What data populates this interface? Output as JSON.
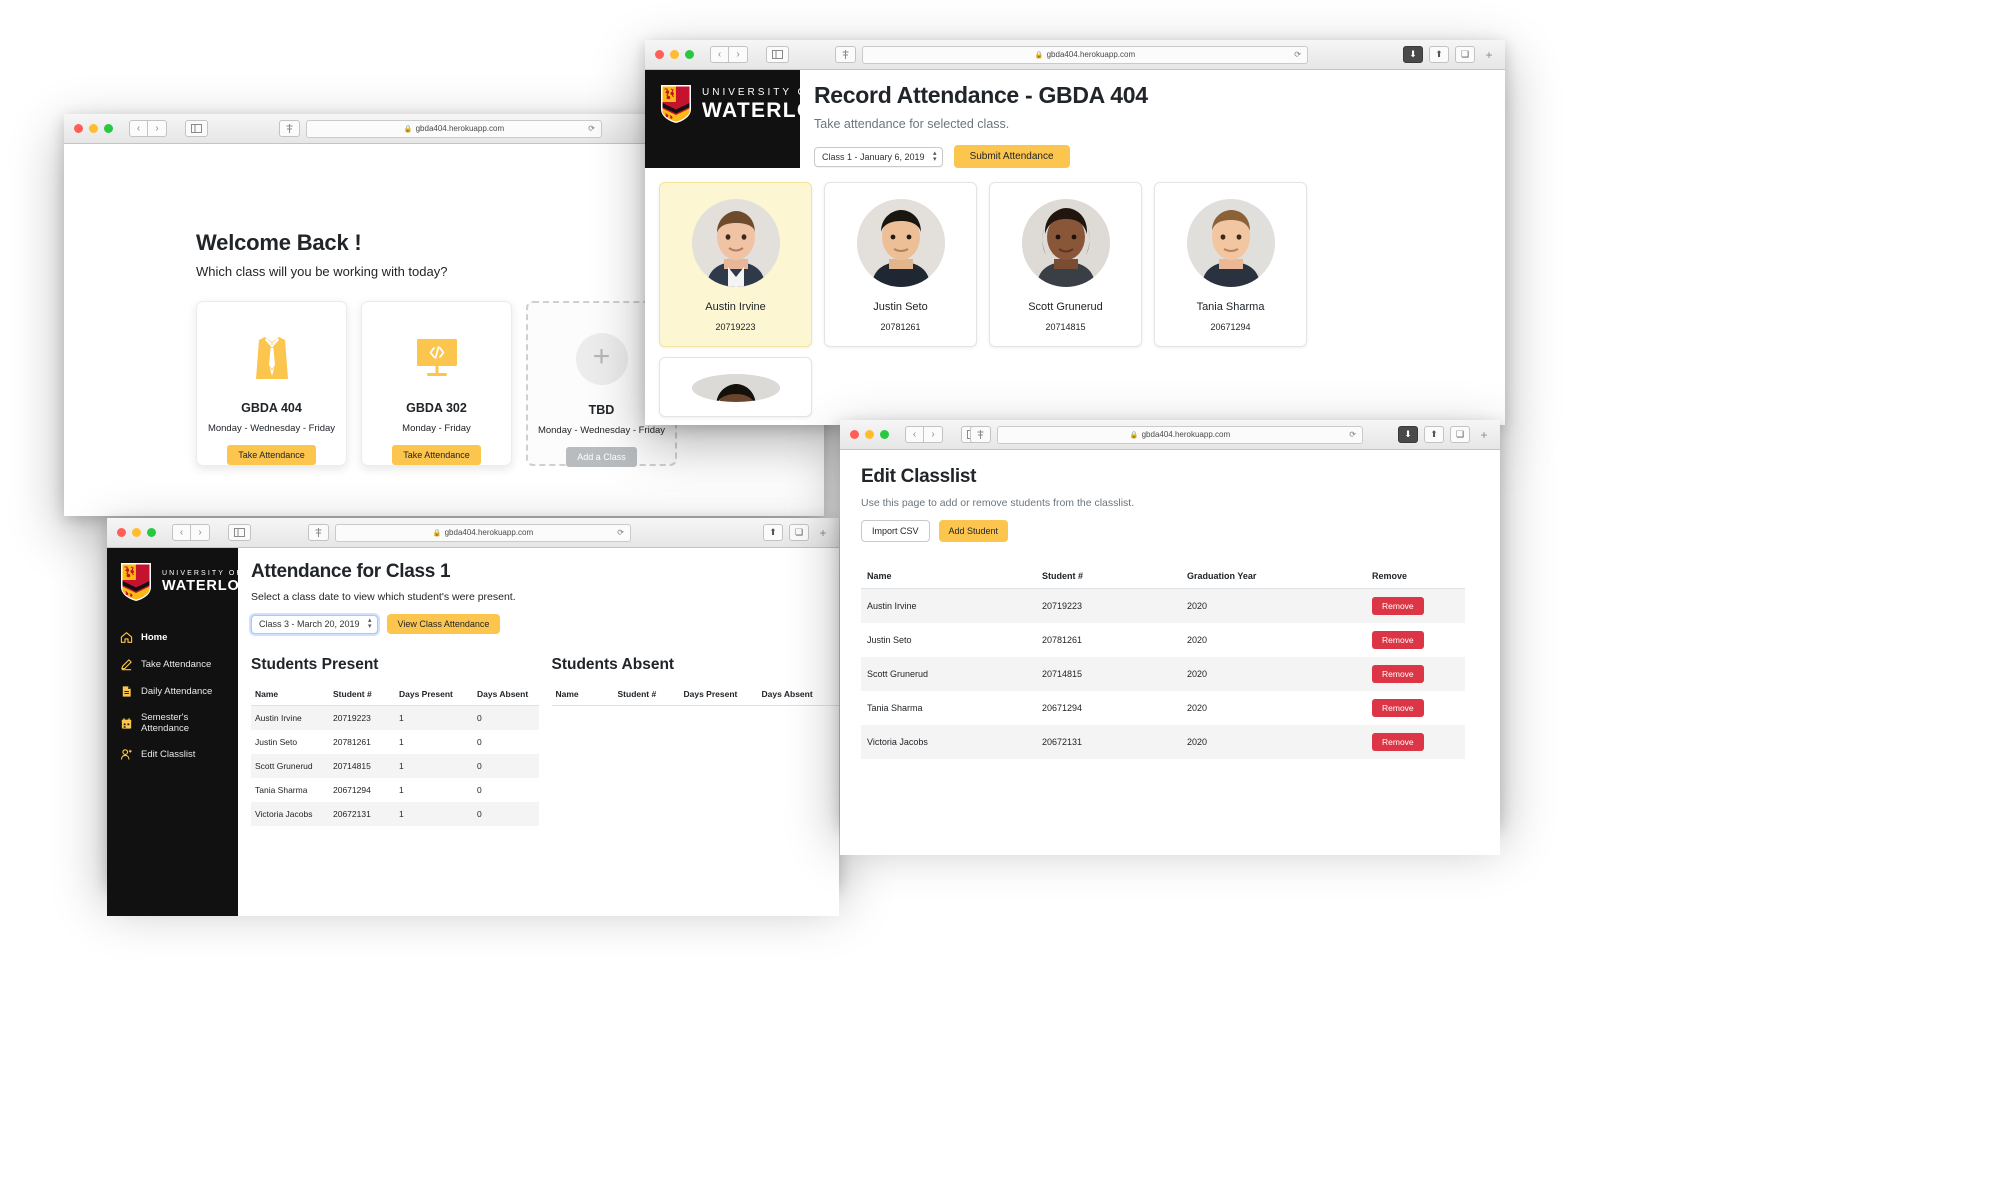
{
  "browser": {
    "url": "gbda404.herokuapp.com",
    "lock_icon": "lock-icon",
    "reload_icon": "reload-icon",
    "back_icon": "chevron-left-icon",
    "forward_icon": "chevron-right-icon",
    "sidebar_icon": "sidebar-toggle-icon",
    "share_icon": "share-icon",
    "download_icon": "download-icon",
    "tabs_icon": "show-tabs-icon",
    "newtab_icon": "plus-icon"
  },
  "brand": {
    "line1": "UNIVERSITY OF",
    "line2": "WATERLOO",
    "accent": "#fcc54d",
    "dark": "#111111",
    "danger": "#dc3545",
    "present": "#1f9d4e",
    "absent": "#e0334a",
    "selected_bg": "#fcf6d2"
  },
  "welcome": {
    "title": "Welcome Back !",
    "subtitle": "Which class will you be working with today?",
    "cards": [
      {
        "icon": "necktie-icon",
        "title": "GBDA 404",
        "days": "Monday - Wednesday - Friday",
        "button": "Take Attendance",
        "state": "normal"
      },
      {
        "icon": "code-monitor-icon",
        "title": "GBDA 302",
        "days": "Monday - Friday",
        "button": "Take Attendance",
        "state": "normal"
      },
      {
        "icon": "plus-icon",
        "title": "TBD",
        "days": "Monday - Wednesday - Friday",
        "button": "Add a Class",
        "state": "placeholder"
      }
    ]
  },
  "record": {
    "title": "Record Attendance - GBDA 404",
    "subtitle": "Take attendance for selected class.",
    "class_select_value": "Class 1 - January 6, 2019",
    "submit_label": "Submit Attendance",
    "students": [
      {
        "name": "Austin Irvine",
        "number": "20719223",
        "selected": true
      },
      {
        "name": "Justin Seto",
        "number": "20781261",
        "selected": false
      },
      {
        "name": "Scott Grunerud",
        "number": "20714815",
        "selected": false
      },
      {
        "name": "Tania Sharma",
        "number": "20671294",
        "selected": false
      }
    ]
  },
  "classpage": {
    "title": "Attendance for Class 1",
    "subtitle": "Select a class date to view which student's were present.",
    "date_select_value": "Class 3 - March 20, 2019",
    "view_button": "View Class Attendance",
    "sidebar": [
      {
        "label": "Home",
        "icon": "home-icon",
        "active": true
      },
      {
        "label": "Take Attendance",
        "icon": "pencil-icon",
        "active": false
      },
      {
        "label": "Daily Attendance",
        "icon": "document-icon",
        "active": false
      },
      {
        "label": "Semester's Attendance",
        "icon": "calendar-icon",
        "active": false
      },
      {
        "label": "Edit Classlist",
        "icon": "user-add-icon",
        "active": false
      }
    ],
    "present_heading": "Students Present",
    "absent_heading": "Students Absent",
    "columns": [
      "Name",
      "Student #",
      "Days Present",
      "Days Absent"
    ],
    "present_rows": [
      {
        "name": "Austin Irvine",
        "number": "20719223",
        "present": "1",
        "absent": "0"
      },
      {
        "name": "Justin Seto",
        "number": "20781261",
        "present": "1",
        "absent": "0"
      },
      {
        "name": "Scott Grunerud",
        "number": "20714815",
        "present": "1",
        "absent": "0"
      },
      {
        "name": "Tania Sharma",
        "number": "20671294",
        "present": "1",
        "absent": "0"
      },
      {
        "name": "Victoria Jacobs",
        "number": "20672131",
        "present": "1",
        "absent": "0"
      }
    ],
    "absent_rows": []
  },
  "editlist": {
    "title": "Edit Classlist",
    "subtitle": "Use this page to add or remove students from the classlist.",
    "import_button": "Import CSV",
    "add_button": "Add Student",
    "columns": [
      "Name",
      "Student #",
      "Graduation Year",
      "Remove"
    ],
    "rows": [
      {
        "name": "Austin Irvine",
        "number": "20719223",
        "year": "2020",
        "action": "Remove"
      },
      {
        "name": "Justin Seto",
        "number": "20781261",
        "year": "2020",
        "action": "Remove"
      },
      {
        "name": "Scott Grunerud",
        "number": "20714815",
        "year": "2020",
        "action": "Remove"
      },
      {
        "name": "Tania Sharma",
        "number": "20671294",
        "year": "2020",
        "action": "Remove"
      },
      {
        "name": "Victoria Jacobs",
        "number": "20672131",
        "year": "2020",
        "action": "Remove"
      }
    ]
  }
}
